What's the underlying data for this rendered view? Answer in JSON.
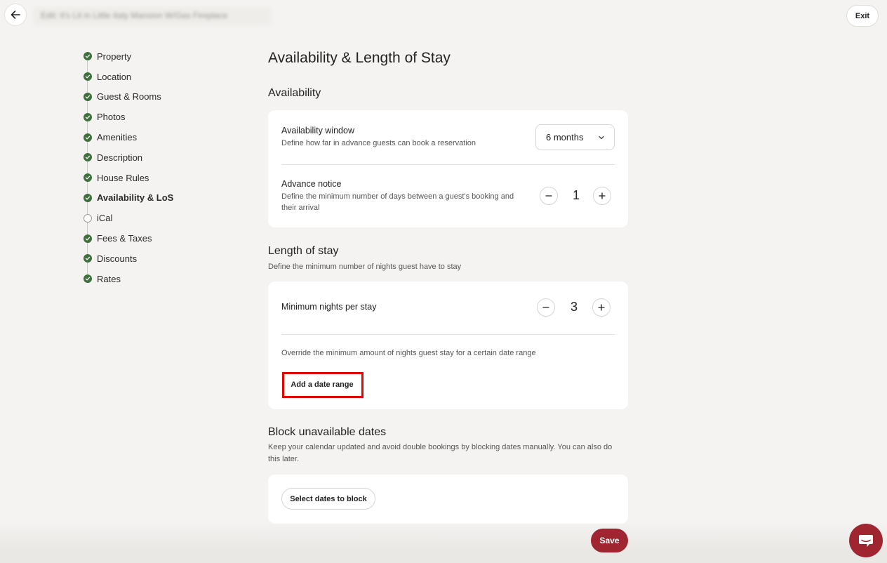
{
  "header": {
    "title": "Edit: It's Lit in Little Italy Mansion W/Gas Fireplace",
    "exit_label": "Exit"
  },
  "sidebar": {
    "items": [
      {
        "label": "Property",
        "done": true
      },
      {
        "label": "Location",
        "done": true
      },
      {
        "label": "Guest & Rooms",
        "done": true
      },
      {
        "label": "Photos",
        "done": true
      },
      {
        "label": "Amenities",
        "done": true
      },
      {
        "label": "Description",
        "done": true
      },
      {
        "label": "House Rules",
        "done": true
      },
      {
        "label": "Availability & LoS",
        "done": true,
        "active": true
      },
      {
        "label": "iCal",
        "done": false
      },
      {
        "label": "Fees & Taxes",
        "done": true
      },
      {
        "label": "Discounts",
        "done": true
      },
      {
        "label": "Rates",
        "done": true
      }
    ]
  },
  "main": {
    "page_title": "Availability & Length of Stay",
    "availability": {
      "title": "Availability",
      "window_label": "Availability window",
      "window_desc": "Define how far in advance guests can book a reservation",
      "window_value": "6 months",
      "notice_label": "Advance notice",
      "notice_desc": "Define the minimum number of days between a guest's booking and their arrival",
      "notice_value": "1"
    },
    "length_of_stay": {
      "title": "Length of stay",
      "subtitle": "Define the minimum number of nights guest have to stay",
      "min_nights_label": "Minimum nights per stay",
      "min_nights_value": "3",
      "override_desc": "Override the minimum amount of nights guest stay for a certain date range",
      "add_range_label": "Add a date range"
    },
    "block": {
      "title": "Block unavailable dates",
      "subtitle": "Keep your calendar updated and avoid double bookings by blocking dates manually. You can also do this later.",
      "select_label": "Select dates to block"
    }
  },
  "footer": {
    "save_label": "Save"
  },
  "colors": {
    "accent": "#9f2631",
    "done_green": "#3f6f3c",
    "highlight": "#e10600"
  }
}
